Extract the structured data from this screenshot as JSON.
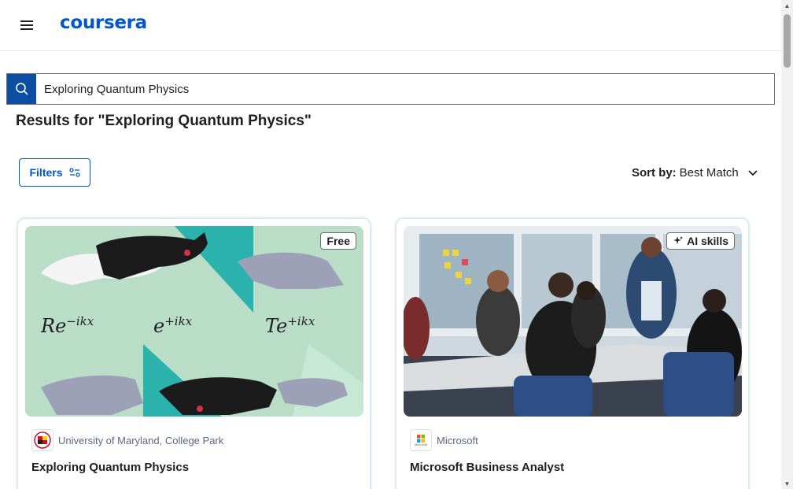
{
  "header": {
    "logo": "coursera",
    "menu_icon": "hamburger-menu-icon"
  },
  "search": {
    "icon": "search-icon",
    "value": "Exploring Quantum Physics"
  },
  "results": {
    "title": "Results for \"Exploring Quantum Physics\""
  },
  "filters": {
    "label": "Filters",
    "icon": "filter-sliders-icon"
  },
  "sort": {
    "label": "Sort by:",
    "value": "Best Match",
    "icon": "chevron-down-icon"
  },
  "cards": [
    {
      "badge": "Free",
      "partner": "University of Maryland, College Park",
      "title": "Exploring Quantum Physics",
      "image_formulas": [
        "Re",
        "−ikx",
        "e",
        "+ikx",
        "Te",
        "+ikx"
      ]
    },
    {
      "badge": "AI skills",
      "badge_icon": "sparkle-icon",
      "partner": "Microsoft",
      "partner_logo_text": "Microsoft",
      "title": "Microsoft Business Analyst"
    }
  ],
  "colors": {
    "brand": "#0056d2",
    "search_button": "#0b4ea2"
  }
}
